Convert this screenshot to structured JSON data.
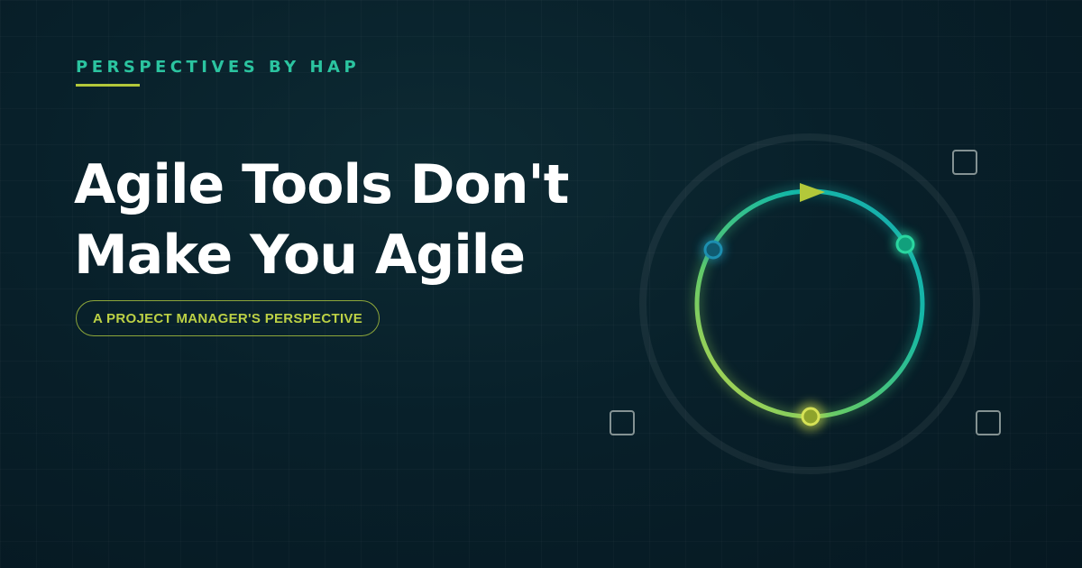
{
  "eyebrow": {
    "label": "PERSPECTIVES BY HAP"
  },
  "headline": {
    "line1": "Agile Tools Don't",
    "line2": "Make You Agile"
  },
  "subtitle_pill": {
    "label": "A PROJECT MANAGER'S PERSPECTIVE"
  },
  "colors": {
    "background": "#08202a",
    "eyebrow": "#2bc4a0",
    "accent_lime": "#b3c83a",
    "ring_teal": "#14b8a6",
    "ring_green": "#7dc85a",
    "node_blue": "#1d8fb0",
    "node_teal": "#2ad6a0",
    "node_lime": "#c8d648"
  },
  "icons": {
    "cycle": "circular-arrow-cycle-icon",
    "nodes": [
      "node-dot-icon",
      "node-dot-icon",
      "node-dot-icon"
    ],
    "squares": [
      "square-outline-icon",
      "square-outline-icon",
      "square-outline-icon"
    ]
  }
}
